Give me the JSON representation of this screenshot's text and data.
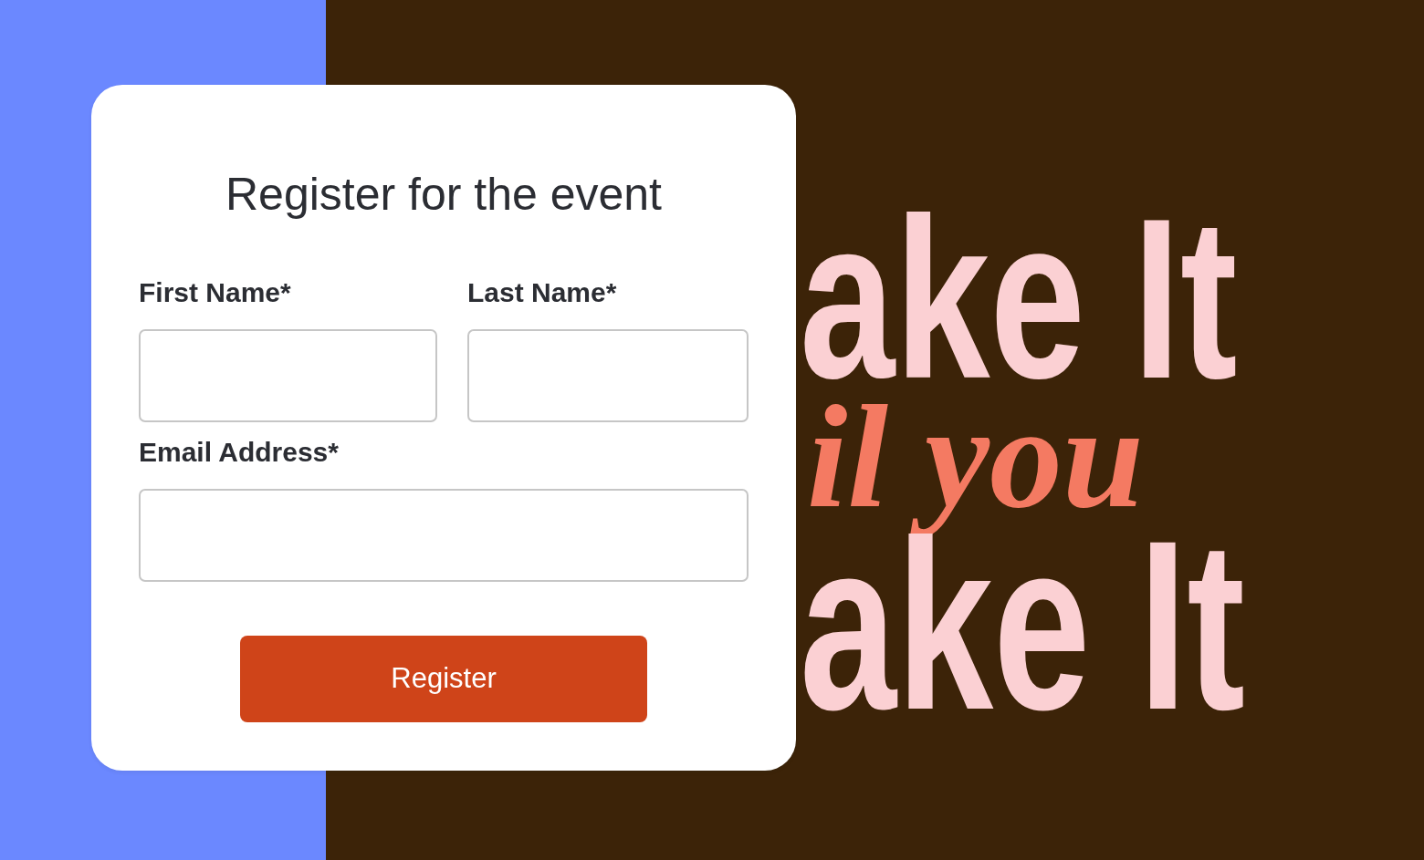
{
  "form": {
    "title": "Register for the event",
    "fields": [
      {
        "label": "First Name*",
        "kind": "half"
      },
      {
        "label": "Last Name*",
        "kind": "half"
      },
      {
        "label": "Email Address*",
        "kind": "full"
      }
    ],
    "submit": "Register"
  },
  "poster": {
    "lines": [
      {
        "text": "ake It",
        "kind": "block"
      },
      {
        "text": "il you",
        "kind": "script"
      },
      {
        "text": "ake It",
        "kind": "block"
      }
    ]
  }
}
